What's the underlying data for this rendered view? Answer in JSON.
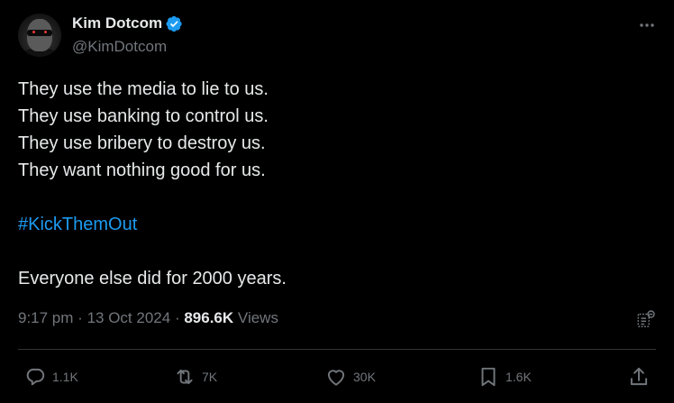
{
  "author": {
    "display_name": "Kim Dotcom",
    "handle": "@KimDotcom",
    "verified": true,
    "avatar_icon": "avatar-photo"
  },
  "tweet": {
    "lines": [
      "They use the media to lie to us.",
      "They use banking to control us.",
      "They use bribery to destroy us.",
      "They want nothing good for us."
    ],
    "hashtag": "#KickThemOut",
    "closing": "Everyone else did for 2000 years."
  },
  "meta": {
    "time": "9:17 pm",
    "separator": "·",
    "date": "13 Oct 2024",
    "views_count": "896.6K",
    "views_label": "Views"
  },
  "actions": {
    "reply_count": "1.1K",
    "retweet_count": "7K",
    "like_count": "30K",
    "bookmark_count": "1.6K"
  },
  "colors": {
    "background": "#000000",
    "text": "#e7e9ea",
    "muted": "#71767b",
    "accent": "#1d9bf0",
    "divider": "#2f3336"
  },
  "icons": {
    "more": "more-dots-icon",
    "verified": "verified-badge-icon",
    "grok": "grok-analyze-icon",
    "reply": "reply-icon",
    "retweet": "retweet-icon",
    "like": "heart-icon",
    "bookmark": "bookmark-icon",
    "share": "share-icon"
  }
}
